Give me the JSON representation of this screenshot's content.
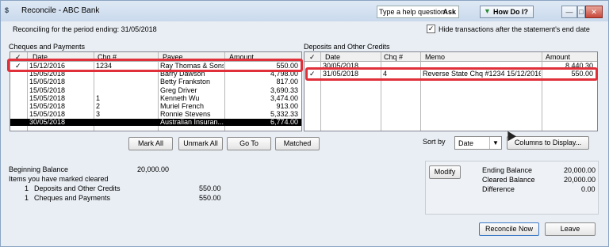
{
  "window": {
    "title": "Reconcile - ABC Bank",
    "app_icon_text": "$",
    "minimize": "—",
    "maximize": "□",
    "close": "✕"
  },
  "help": {
    "input_value": "Type a help question",
    "ask_label": "Ask",
    "how_do_i_label": "How Do I?",
    "how_do_i_icon": "triangle-down-icon"
  },
  "header": {
    "period_text": "Reconciling for the period ending: 31/05/2018",
    "hide_label": "Hide transactions after the statement's end date",
    "hide_checked": "✓"
  },
  "cheques": {
    "section_title": "Cheques and Payments",
    "columns": {
      "check": "✓",
      "date": "Date",
      "chq": "Chq #",
      "payee": "Payee",
      "amount": "Amount"
    },
    "rows": [
      {
        "check": "✓",
        "date": "15/12/2016",
        "chq": "1234",
        "payee": "Ray Thomas & Sons",
        "amount": "550.00"
      },
      {
        "check": "",
        "date": "15/05/2018",
        "chq": "",
        "payee": "Barry Dawson",
        "amount": "4,798.00"
      },
      {
        "check": "",
        "date": "15/05/2018",
        "chq": "",
        "payee": "Betty Frankston",
        "amount": "817.00"
      },
      {
        "check": "",
        "date": "15/05/2018",
        "chq": "",
        "payee": "Greg Driver",
        "amount": "3,690.33"
      },
      {
        "check": "",
        "date": "15/05/2018",
        "chq": "1",
        "payee": "Kenneth Wu",
        "amount": "3,474.00"
      },
      {
        "check": "",
        "date": "15/05/2018",
        "chq": "2",
        "payee": "Muriel French",
        "amount": "913.00"
      },
      {
        "check": "",
        "date": "15/05/2018",
        "chq": "3",
        "payee": "Ronnie Stevens",
        "amount": "5,332.33"
      },
      {
        "check": "",
        "date": "30/05/2018",
        "chq": "",
        "payee": "Australian Insuran...",
        "amount": "6,774.00"
      }
    ]
  },
  "deposits": {
    "section_title": "Deposits and Other Credits",
    "columns": {
      "check": "✓",
      "date": "Date",
      "chq": "Chq #",
      "memo": "Memo",
      "amount": "Amount"
    },
    "rows": [
      {
        "check": "",
        "date": "30/05/2018",
        "chq": "",
        "memo": "",
        "amount": "8,440.30"
      },
      {
        "check": "✓",
        "date": "31/05/2018",
        "chq": "4",
        "memo": "Reverse State Chq #1234 15/12/2016",
        "amount": "550.00"
      }
    ]
  },
  "buttons": {
    "mark_all": "Mark All",
    "unmark_all": "Unmark All",
    "go_to": "Go To",
    "matched": "Matched",
    "columns_to_display": "Columns to Display...",
    "modify": "Modify",
    "reconcile_now": "Reconcile Now",
    "leave": "Leave"
  },
  "sort": {
    "label": "Sort by",
    "value": "Date",
    "arrow": "▼"
  },
  "summary": {
    "beginning_balance_label": "Beginning Balance",
    "beginning_balance": "20,000.00",
    "marked_cleared_label": "Items you have marked cleared",
    "deposits_count": "1",
    "deposits_label": "Deposits and Other Credits",
    "deposits_value": "550.00",
    "cheques_count": "1",
    "cheques_label": "Cheques and Payments",
    "cheques_value": "550.00"
  },
  "balances": {
    "ending_label": "Ending Balance",
    "ending_value": "20,000.00",
    "cleared_label": "Cleared Balance",
    "cleared_value": "20,000.00",
    "difference_label": "Difference",
    "difference_value": "0.00"
  },
  "colors": {
    "highlight": "#e0303a",
    "selected_row": "#000000"
  }
}
